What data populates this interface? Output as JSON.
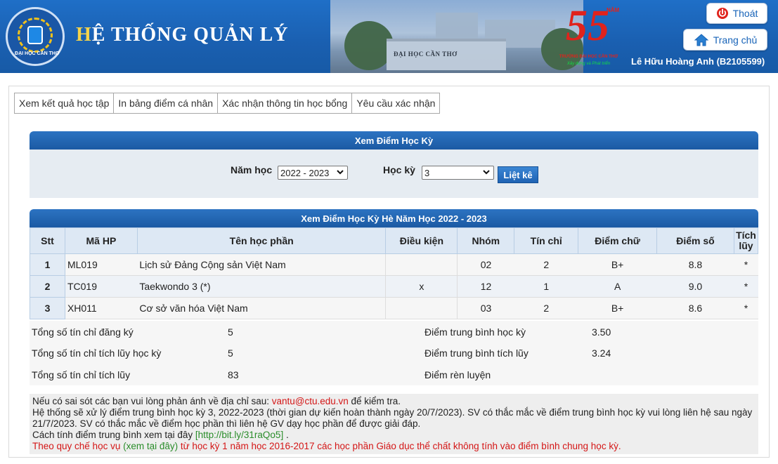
{
  "header": {
    "title_first": "H",
    "title_rest": "Ệ THỐNG QUẢN LÝ",
    "logo_text": "ĐẠI HỌC CẦN THƠ",
    "gate_text": "ĐẠI HỌC CẦN THƠ",
    "anniversary_number": "55",
    "anniversary_unit": "NĂM",
    "anniversary_caption": "TRƯỜNG ĐẠI HỌC CẦN THƠ",
    "anniversary_slogan": "Xây dựng và Phát triển",
    "logout_label": "Thoát",
    "home_label": "Trang chủ",
    "user_name": "Lê Hữu Hoàng Anh (B2105599)"
  },
  "tabs": [
    {
      "label": "Xem kết quả học tập"
    },
    {
      "label": "In bảng điểm cá nhân"
    },
    {
      "label": "Xác nhận thông tin học bổng"
    },
    {
      "label": "Yêu cầu xác nhận"
    }
  ],
  "filter": {
    "title": "Xem Điểm Học Kỳ",
    "year_label": "Năm học",
    "year_value": "2022 - 2023",
    "semester_label": "Học kỳ",
    "semester_value": "3",
    "list_button": "Liệt kê"
  },
  "grades": {
    "title": "Xem Điểm Học Kỳ Hè Năm Học 2022 - 2023",
    "columns": [
      "Stt",
      "Mã HP",
      "Tên học phần",
      "Điều kiện",
      "Nhóm",
      "Tín chỉ",
      "Điểm chữ",
      "Điểm số",
      "Tích lũy"
    ],
    "rows": [
      {
        "stt": "1",
        "code": "ML019",
        "name": "Lịch sử Đảng Cộng sản Việt Nam",
        "condition": "",
        "group": "02",
        "credits": "2",
        "letter": "B+",
        "score": "8.8",
        "accum": "*"
      },
      {
        "stt": "2",
        "code": "TC019",
        "name": "Taekwondo 3 (*)",
        "condition": "x",
        "group": "12",
        "credits": "1",
        "letter": "A",
        "score": "9.0",
        "accum": "*"
      },
      {
        "stt": "3",
        "code": "XH011",
        "name": "Cơ sở văn hóa Việt Nam",
        "condition": "",
        "group": "03",
        "credits": "2",
        "letter": "B+",
        "score": "8.6",
        "accum": "*"
      }
    ]
  },
  "summary": {
    "registered_label": "Tổng số tín chỉ đăng ký",
    "registered_value": "5",
    "semester_accum_label": "Tổng số tín chỉ tích lũy học kỳ",
    "semester_accum_value": "5",
    "total_accum_label": "Tổng số tín chỉ tích lũy",
    "total_accum_value": "83",
    "gpa_semester_label": "Điểm trung bình học kỳ",
    "gpa_semester_value": "3.50",
    "gpa_accum_label": "Điểm trung bình tích lũy",
    "gpa_accum_value": "3.24",
    "conduct_label": "Điểm rèn luyện",
    "conduct_value": ""
  },
  "notes": {
    "line1_pre": "Nếu có sai sót các bạn vui lòng phản ánh về địa chỉ sau: ",
    "line1_email": "vantu@ctu.edu.vn",
    "line1_post": " để kiểm tra.",
    "line2": "Hệ thống sẽ xử lý điểm trung bình học kỳ 3, 2022-2023 (thời gian dự kiến hoàn thành ngày 20/7/2023). SV có thắc mắc về điểm trung bình học kỳ vui lòng liên hệ sau ngày 21/7/2023. SV có thắc mắc về điểm học phần thì liên hệ GV dạy học phần để được giải đáp.",
    "line3_pre": "Cách tính điểm trung bình xem tại đây ",
    "line3_link": "[http://bit.ly/31raQo5]",
    "line3_post": " .",
    "line4_pre": "Theo quy chế học vụ ",
    "line4_link": "(xem tại đây)",
    "line4_post": " từ học kỳ 1 năm học 2016-2017 các học phần Giáo dục thể chất không tính vào điểm bình chung học kỳ."
  },
  "colors": {
    "header_blue": "#1a5fb0",
    "section_blue": "#1b5aa3",
    "accent_red": "#d41616",
    "link_green": "#2a8d2a"
  },
  "icons": [
    "power-icon",
    "home-icon",
    "select-chevron-icon"
  ]
}
